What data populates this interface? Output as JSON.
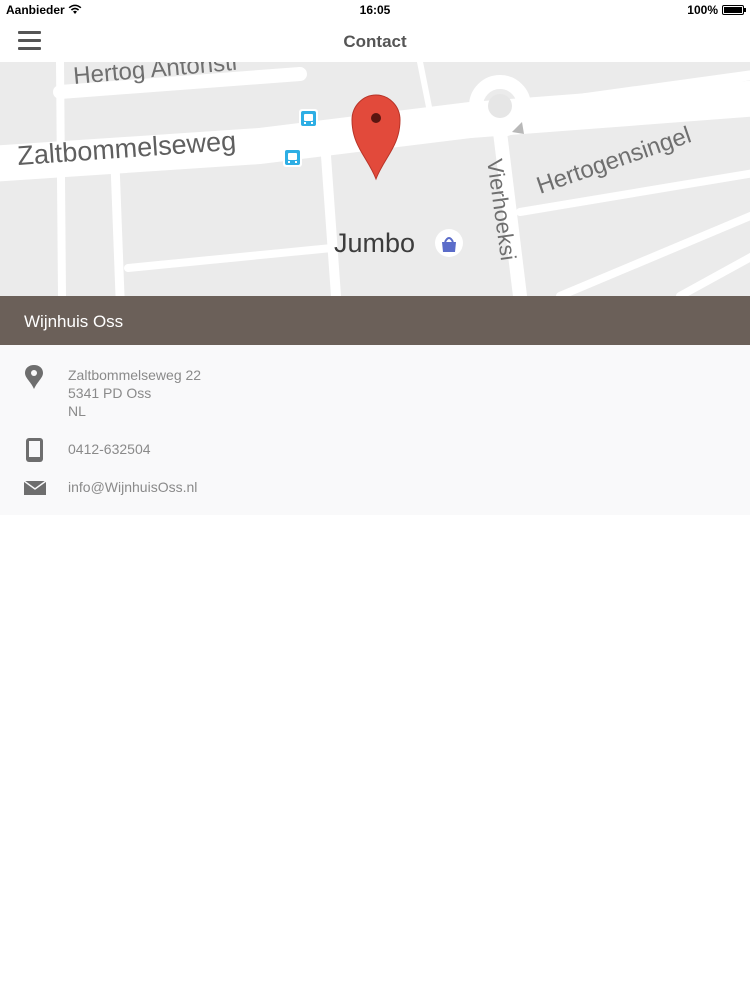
{
  "status_bar": {
    "carrier": "Aanbieder",
    "time": "16:05",
    "battery": "100%"
  },
  "nav": {
    "title": "Contact"
  },
  "map": {
    "labels": {
      "street_top": "Hertog Antonstr",
      "street_main": "Zaltbommelseweg",
      "street_right": "Hertogensingel",
      "street_vertical": "Vierhoeksi",
      "poi": "Jumbo"
    }
  },
  "place": {
    "name": "Wijnhuis Oss",
    "address_line1": "Zaltbommelseweg 22",
    "address_line2": "5341 PD Oss",
    "address_line3": "NL",
    "phone": "0412-632504",
    "email": "info@WijnhuisOss.nl"
  },
  "colors": {
    "header_band": "#6b6059",
    "details_bg": "#f9f9fa",
    "pin": "#e24a3b"
  }
}
